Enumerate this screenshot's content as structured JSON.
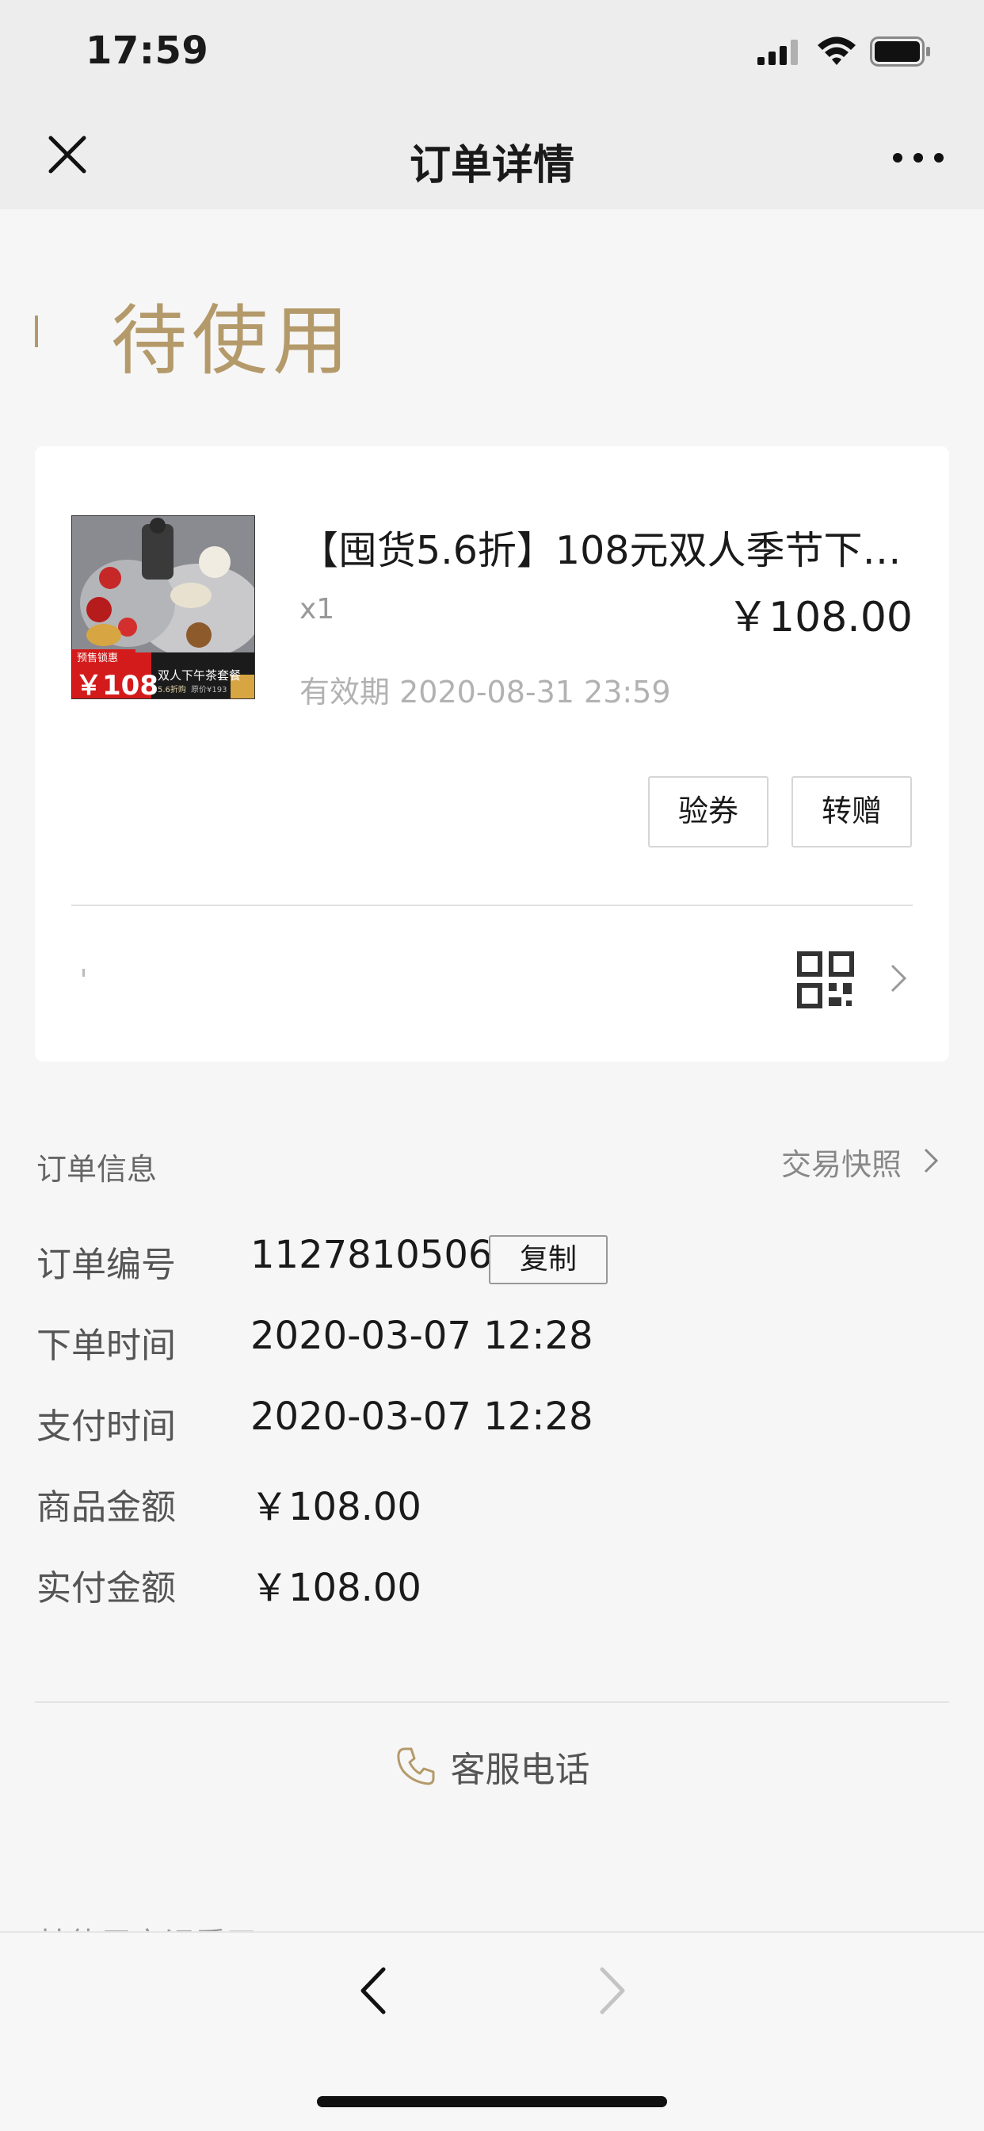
{
  "status_bar": {
    "time": "17:59"
  },
  "nav": {
    "title": "订单详情"
  },
  "order_status": "待使用",
  "product": {
    "title": "【囤货5.6折】108元双人季节下…",
    "quantity": "x1",
    "price": "￥108.00",
    "validity_label": "有效期",
    "validity_value": "2020-08-31 23:59",
    "image": {
      "badge": "预售锁惠",
      "price_tag": "￥108",
      "caption_main": "双人下午茶套餐",
      "caption_sub": "5.6折购",
      "caption_old": "原价¥193"
    }
  },
  "actions": {
    "verify": "验券",
    "gift": "转赠"
  },
  "order_info": {
    "title": "订单信息",
    "snapshot_link": "交易快照",
    "copy_button": "复制",
    "rows": [
      {
        "label": "订单编号",
        "value": "1127810506"
      },
      {
        "label": "下单时间",
        "value": "2020-03-07 12:28"
      },
      {
        "label": "支付时间",
        "value": "2020-03-07 12:28"
      },
      {
        "label": "商品金额",
        "value": "￥108.00"
      },
      {
        "label": "实付金额",
        "value": "￥108.00"
      }
    ]
  },
  "customer_service": {
    "label": "客服电话"
  },
  "peek_text": "某使用方记看了",
  "colors": {
    "accent_gold": "#b49a6a",
    "background": "#f6f6f6",
    "card": "#ffffff"
  }
}
